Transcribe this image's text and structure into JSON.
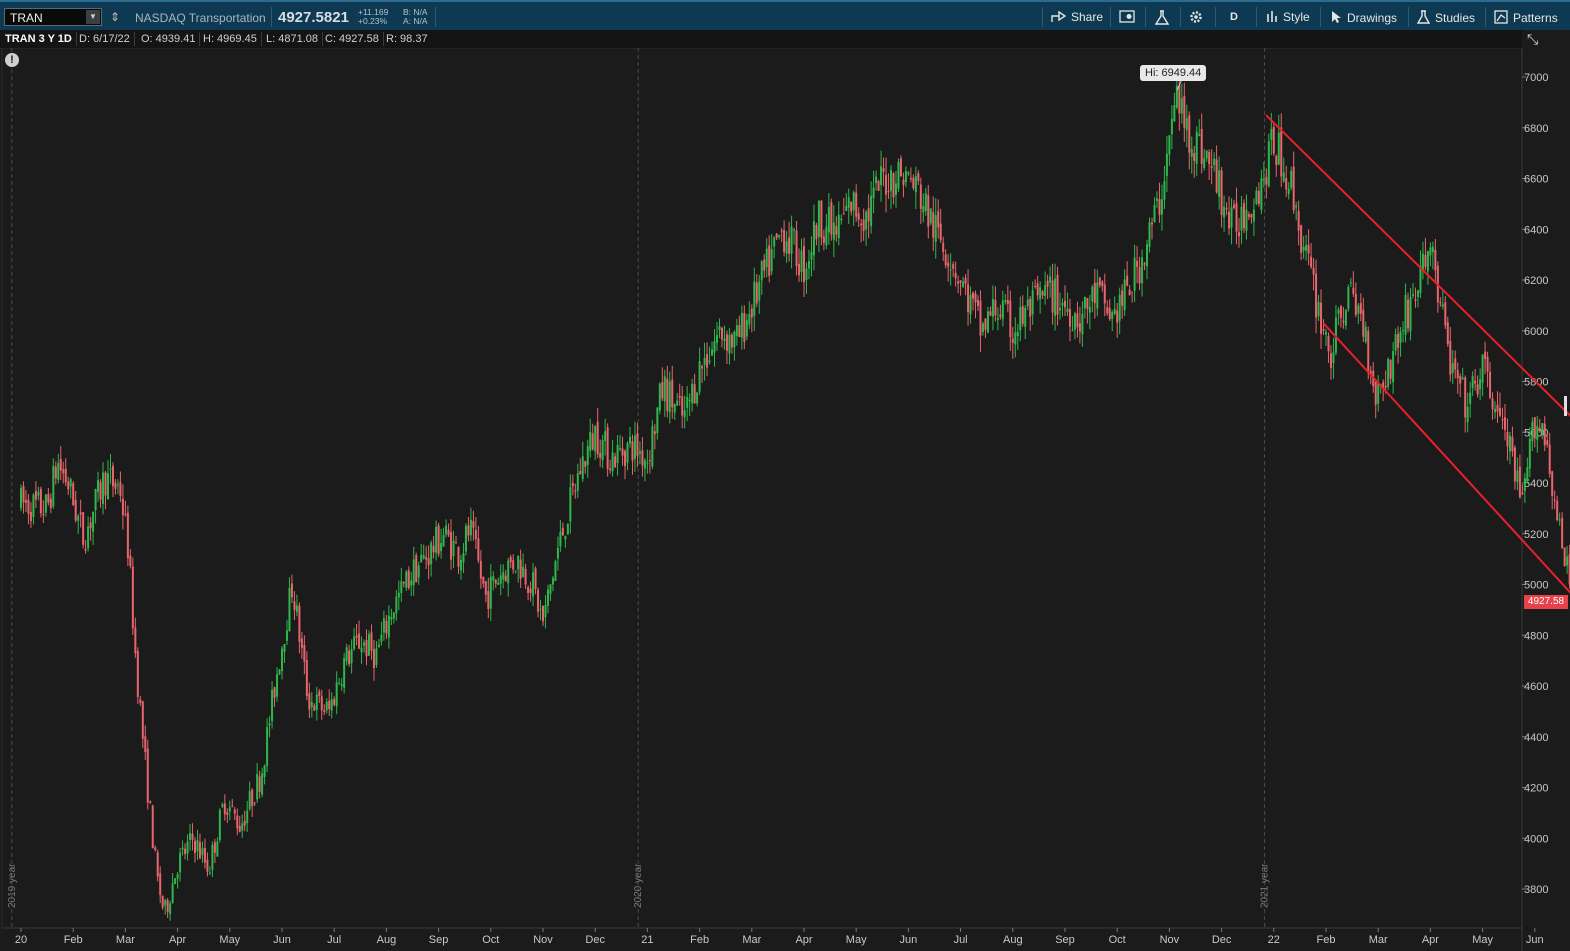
{
  "header": {
    "symbol": "TRAN",
    "description": "NASDAQ Transportation",
    "last_price": "4927.5821",
    "net_change": "+11.169",
    "pct_change": "+0.23%",
    "bid": "B: N/A",
    "ask": "A: N/A"
  },
  "toolbar": {
    "share": "Share",
    "aggregation": "D",
    "style": "Style",
    "drawings": "Drawings",
    "studies": "Studies",
    "patterns": "Patterns"
  },
  "info": {
    "chart_id": "TRAN 3 Y 1D",
    "date": "D: 6/17/22",
    "open": "O: 4939.41",
    "high": "H: 4969.45",
    "low": "L: 4871.08",
    "close": "C: 4927.58",
    "range": "R: 98.37"
  },
  "annotations": {
    "high_label": "Hi: 6949.44",
    "last_price_tag": "4927.58"
  },
  "colors": {
    "background": "#1b1b1b",
    "header_bg": "#0d3a52",
    "up": "#2eb84b",
    "down": "#e8656d",
    "trendline": "#e8202c"
  },
  "chart_data": {
    "type": "candlestick",
    "y_range": [
      3640,
      7200
    ],
    "y_ticks": [
      3800,
      4000,
      4200,
      4400,
      4600,
      4800,
      5000,
      5200,
      5400,
      5600,
      5800,
      6000,
      6200,
      6400,
      6600,
      6800,
      7000
    ],
    "x_range": [
      0,
      30
    ],
    "x_ticks": [
      {
        "m": 0,
        "label": "20"
      },
      {
        "m": 1,
        "label": "Feb"
      },
      {
        "m": 2,
        "label": "Mar"
      },
      {
        "m": 3,
        "label": "Apr"
      },
      {
        "m": 4,
        "label": "May"
      },
      {
        "m": 5,
        "label": "Jun"
      },
      {
        "m": 6,
        "label": "Jul"
      },
      {
        "m": 7,
        "label": "Aug"
      },
      {
        "m": 8,
        "label": "Sep"
      },
      {
        "m": 9,
        "label": "Oct"
      },
      {
        "m": 10,
        "label": "Nov"
      },
      {
        "m": 11,
        "label": "Dec"
      },
      {
        "m": 12,
        "label": "21"
      },
      {
        "m": 13,
        "label": "Feb"
      },
      {
        "m": 14,
        "label": "Mar"
      },
      {
        "m": 15,
        "label": "Apr"
      },
      {
        "m": 16,
        "label": "May"
      },
      {
        "m": 17,
        "label": "Jun"
      },
      {
        "m": 18,
        "label": "Jul"
      },
      {
        "m": 19,
        "label": "Aug"
      },
      {
        "m": 20,
        "label": "Sep"
      },
      {
        "m": 21,
        "label": "Oct"
      },
      {
        "m": 22,
        "label": "Nov"
      },
      {
        "m": 23,
        "label": "Dec"
      },
      {
        "m": 24,
        "label": "22"
      },
      {
        "m": 25,
        "label": "Feb"
      },
      {
        "m": 26,
        "label": "Mar"
      },
      {
        "m": 27,
        "label": "Apr"
      },
      {
        "m": 28,
        "label": "May"
      },
      {
        "m": 29,
        "label": "Jun"
      }
    ],
    "year_lines": [
      {
        "m": -0.1,
        "label": "2019 year"
      },
      {
        "m": 11.9,
        "label": "2020 year"
      },
      {
        "m": 23.9,
        "label": "2021 year"
      }
    ],
    "price_path": [
      [
        0.0,
        5320
      ],
      [
        0.5,
        5300
      ],
      [
        0.7,
        5480
      ],
      [
        0.9,
        5400
      ],
      [
        1.2,
        5180
      ],
      [
        1.6,
        5420
      ],
      [
        1.9,
        5380
      ],
      [
        2.05,
        5150
      ],
      [
        2.2,
        4700
      ],
      [
        2.4,
        4250
      ],
      [
        2.6,
        3850
      ],
      [
        2.75,
        3700
      ],
      [
        3.0,
        3900
      ],
      [
        3.3,
        4000
      ],
      [
        3.6,
        3880
      ],
      [
        3.9,
        4150
      ],
      [
        4.2,
        4050
      ],
      [
        4.6,
        4250
      ],
      [
        4.9,
        4650
      ],
      [
        5.2,
        5000
      ],
      [
        5.5,
        4550
      ],
      [
        5.9,
        4500
      ],
      [
        6.2,
        4700
      ],
      [
        6.5,
        4780
      ],
      [
        6.8,
        4720
      ],
      [
        7.1,
        4900
      ],
      [
        7.5,
        5050
      ],
      [
        7.8,
        5120
      ],
      [
        8.1,
        5200
      ],
      [
        8.4,
        5120
      ],
      [
        8.6,
        5220
      ],
      [
        8.9,
        4950
      ],
      [
        9.2,
        5050
      ],
      [
        9.5,
        5100
      ],
      [
        9.8,
        5000
      ],
      [
        10.0,
        4850
      ],
      [
        10.3,
        5150
      ],
      [
        10.7,
        5450
      ],
      [
        11.0,
        5600
      ],
      [
        11.3,
        5500
      ],
      [
        11.7,
        5550
      ],
      [
        12.0,
        5500
      ],
      [
        12.3,
        5780
      ],
      [
        12.7,
        5650
      ],
      [
        13.0,
        5850
      ],
      [
        13.4,
        6000
      ],
      [
        13.7,
        5950
      ],
      [
        14.0,
        6100
      ],
      [
        14.3,
        6250
      ],
      [
        14.6,
        6400
      ],
      [
        15.0,
        6250
      ],
      [
        15.3,
        6450
      ],
      [
        15.6,
        6380
      ],
      [
        15.9,
        6500
      ],
      [
        16.2,
        6450
      ],
      [
        16.5,
        6600
      ],
      [
        16.9,
        6620
      ],
      [
        17.2,
        6550
      ],
      [
        17.5,
        6400
      ],
      [
        17.8,
        6300
      ],
      [
        18.1,
        6150
      ],
      [
        18.4,
        6000
      ],
      [
        18.7,
        6100
      ],
      [
        19.0,
        6000
      ],
      [
        19.3,
        6080
      ],
      [
        19.7,
        6150
      ],
      [
        20.0,
        6100
      ],
      [
        20.3,
        6050
      ],
      [
        20.6,
        6150
      ],
      [
        20.9,
        6050
      ],
      [
        21.2,
        6150
      ],
      [
        21.5,
        6300
      ],
      [
        21.8,
        6500
      ],
      [
        22.0,
        6750
      ],
      [
        22.15,
        6940
      ],
      [
        22.3,
        6800
      ],
      [
        22.6,
        6720
      ],
      [
        22.9,
        6600
      ],
      [
        23.2,
        6400
      ],
      [
        23.5,
        6500
      ],
      [
        23.8,
        6600
      ],
      [
        24.0,
        6750
      ],
      [
        24.3,
        6600
      ],
      [
        24.6,
        6300
      ],
      [
        24.9,
        6050
      ],
      [
        25.1,
        5900
      ],
      [
        25.4,
        6150
      ],
      [
        25.7,
        6050
      ],
      [
        25.95,
        5750
      ],
      [
        26.2,
        5850
      ],
      [
        26.5,
        6050
      ],
      [
        26.8,
        6200
      ],
      [
        27.0,
        6350
      ],
      [
        27.15,
        6150
      ],
      [
        27.4,
        5850
      ],
      [
        27.7,
        5700
      ],
      [
        28.0,
        5850
      ],
      [
        28.25,
        5700
      ],
      [
        28.5,
        5550
      ],
      [
        28.75,
        5300
      ],
      [
        29.0,
        5650
      ],
      [
        29.2,
        5600
      ],
      [
        29.4,
        5300
      ],
      [
        29.55,
        5100
      ],
      [
        29.75,
        4960
      ]
    ],
    "trend_lines": [
      {
        "from": [
          23.85,
          6850
        ],
        "to": [
          30.0,
          5600
        ]
      },
      {
        "from": [
          24.95,
          6030
        ],
        "to": [
          29.85,
          4930
        ]
      }
    ],
    "high_point": {
      "m": 22.15,
      "value": 6949.44
    },
    "last": 4927.58
  }
}
